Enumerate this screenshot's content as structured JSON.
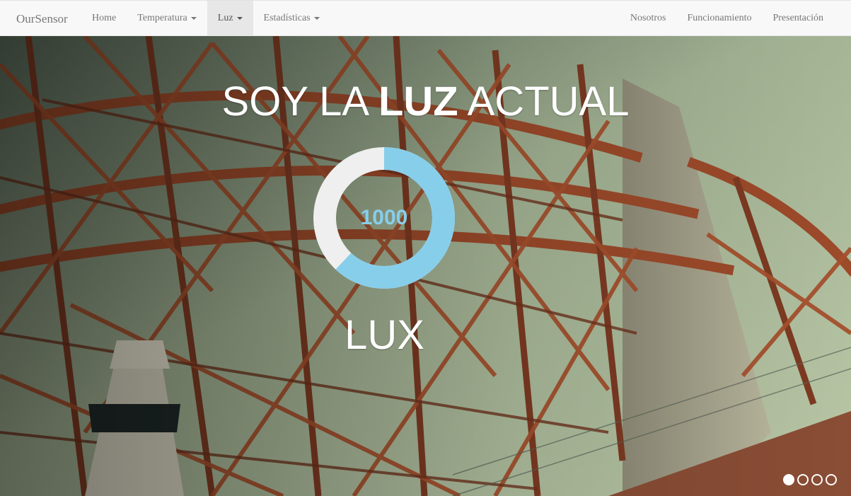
{
  "navbar": {
    "brand": "OurSensor",
    "left_items": [
      {
        "label": "Home",
        "dropdown": false,
        "active": false
      },
      {
        "label": "Temperatura",
        "dropdown": true,
        "active": false
      },
      {
        "label": "Luz",
        "dropdown": true,
        "active": true
      },
      {
        "label": "Estadísticas",
        "dropdown": true,
        "active": false
      }
    ],
    "right_items": [
      {
        "label": "Nosotros"
      },
      {
        "label": "Funcionamiento"
      },
      {
        "label": "Presentación"
      }
    ]
  },
  "hero": {
    "title_before": "SOY LA ",
    "title_bold": "LUZ",
    "title_after": " ACTUAL",
    "gauge_value": "1000",
    "gauge_fraction": 0.62,
    "unit": "LUX",
    "background_image": "steel-bridge-photo"
  },
  "carousel": {
    "slide_count": 4,
    "active_index": 0
  },
  "colors": {
    "gauge_fill": "#87ceeb",
    "gauge_track": "#efefef",
    "navbar_bg": "#f8f8f8",
    "nav_text": "#777777",
    "hero_text": "#ffffff"
  }
}
